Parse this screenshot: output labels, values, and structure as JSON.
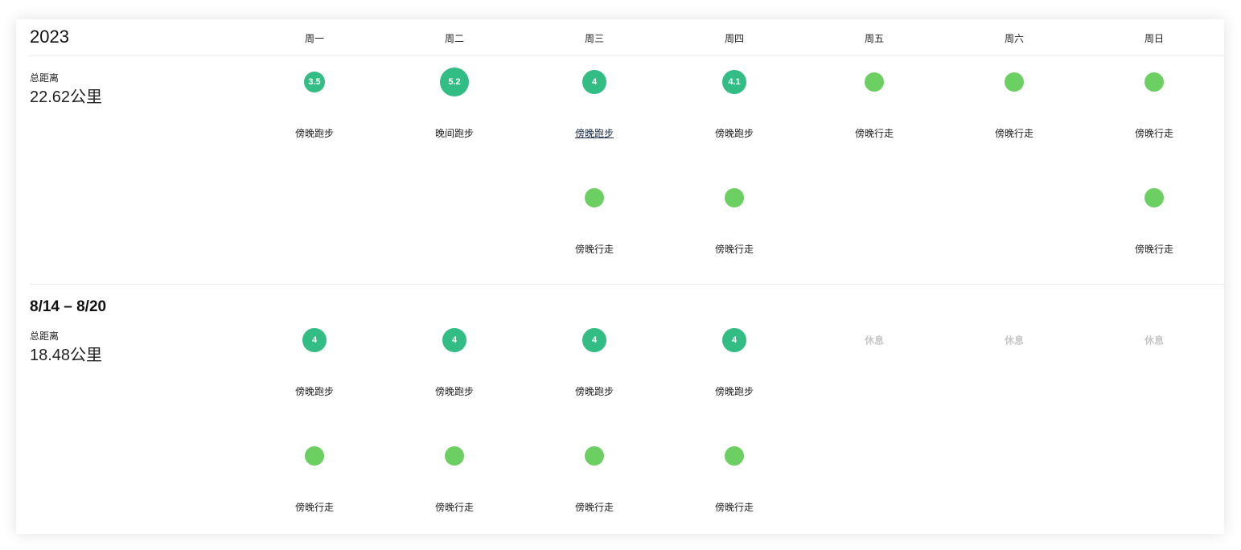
{
  "year": "2023",
  "days": [
    "周一",
    "周二",
    "周三",
    "周四",
    "周五",
    "周六",
    "周日"
  ],
  "distance_label": "总距离",
  "colors": {
    "run": "#32bd85",
    "walk": "#6ccf61",
    "rest_text": "#c8c8c8"
  },
  "week1": {
    "total": "22.62公里",
    "activities": [
      {
        "day": 0,
        "slot": 0,
        "type": "run",
        "value": "3.5",
        "name": "傍晚跑步"
      },
      {
        "day": 1,
        "slot": 0,
        "type": "run",
        "value": "5.2",
        "name": "晚间跑步"
      },
      {
        "day": 2,
        "slot": 0,
        "type": "run",
        "value": "4",
        "name": "傍晚跑步",
        "link": true
      },
      {
        "day": 3,
        "slot": 0,
        "type": "run",
        "value": "4.1",
        "name": "傍晚跑步"
      },
      {
        "day": 4,
        "slot": 0,
        "type": "walk",
        "name": "傍晚行走"
      },
      {
        "day": 5,
        "slot": 0,
        "type": "walk",
        "name": "傍晚行走"
      },
      {
        "day": 6,
        "slot": 0,
        "type": "walk",
        "name": "傍晚行走"
      },
      {
        "day": 2,
        "slot": 1,
        "type": "walk",
        "name": "傍晚行走"
      },
      {
        "day": 3,
        "slot": 1,
        "type": "walk",
        "name": "傍晚行走"
      },
      {
        "day": 6,
        "slot": 1,
        "type": "walk",
        "name": "傍晚行走"
      }
    ]
  },
  "week2": {
    "range": "8/14 – 8/20",
    "total": "18.48公里",
    "activities": [
      {
        "day": 0,
        "slot": 0,
        "type": "run",
        "value": "4",
        "name": "傍晚跑步"
      },
      {
        "day": 1,
        "slot": 0,
        "type": "run",
        "value": "4",
        "name": "傍晚跑步"
      },
      {
        "day": 2,
        "slot": 0,
        "type": "run",
        "value": "4",
        "name": "傍晚跑步"
      },
      {
        "day": 3,
        "slot": 0,
        "type": "run",
        "value": "4",
        "name": "傍晚跑步"
      },
      {
        "day": 0,
        "slot": 1,
        "type": "walk",
        "name": "傍晚行走"
      },
      {
        "day": 1,
        "slot": 1,
        "type": "walk",
        "name": "傍晚行走"
      },
      {
        "day": 2,
        "slot": 1,
        "type": "walk",
        "name": "傍晚行走"
      },
      {
        "day": 3,
        "slot": 1,
        "type": "walk",
        "name": "傍晚行走"
      }
    ],
    "rest_days": [
      4,
      5,
      6
    ],
    "rest_label": "休息"
  }
}
